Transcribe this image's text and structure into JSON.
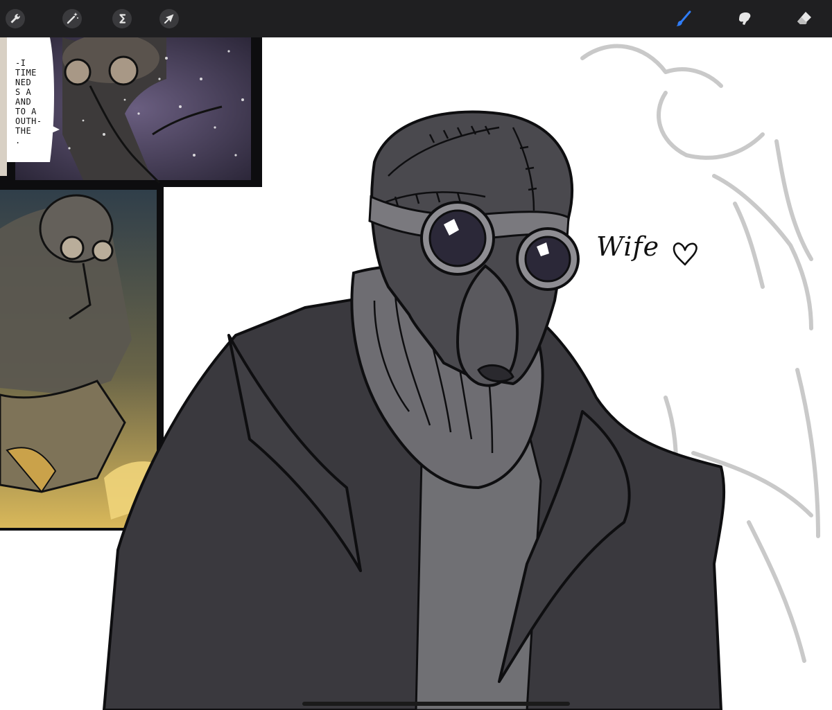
{
  "app": {
    "toolbar": {
      "left_tools": [
        {
          "icon": "wrench-icon",
          "label": "Actions"
        },
        {
          "icon": "magic-wand-icon",
          "label": "Adjustments"
        },
        {
          "icon": "selection-s-icon",
          "label": "Selection"
        },
        {
          "icon": "arrow-cursor-icon",
          "label": "Transform"
        }
      ],
      "right_tools": [
        {
          "icon": "brush-icon",
          "label": "Paint",
          "active": true
        },
        {
          "icon": "smudge-icon",
          "label": "Smudge",
          "active": false
        },
        {
          "icon": "eraser-icon",
          "label": "Erase",
          "active": false
        }
      ],
      "accent_color": "#2f7cf6"
    }
  },
  "canvas": {
    "reference_panel_bubble_text": "-I\nTIME\nNED\nS A\nAND\nTO A\nOUTH-\nTHE\n.",
    "annotation_text": "Wife",
    "annotation_symbol": "heart-icon",
    "colors": {
      "coat": "#3a393e",
      "sweater": "#6e6d72",
      "head": "#4a494e",
      "lens": "#2b2838",
      "sketch": "#c9c9c9"
    }
  }
}
